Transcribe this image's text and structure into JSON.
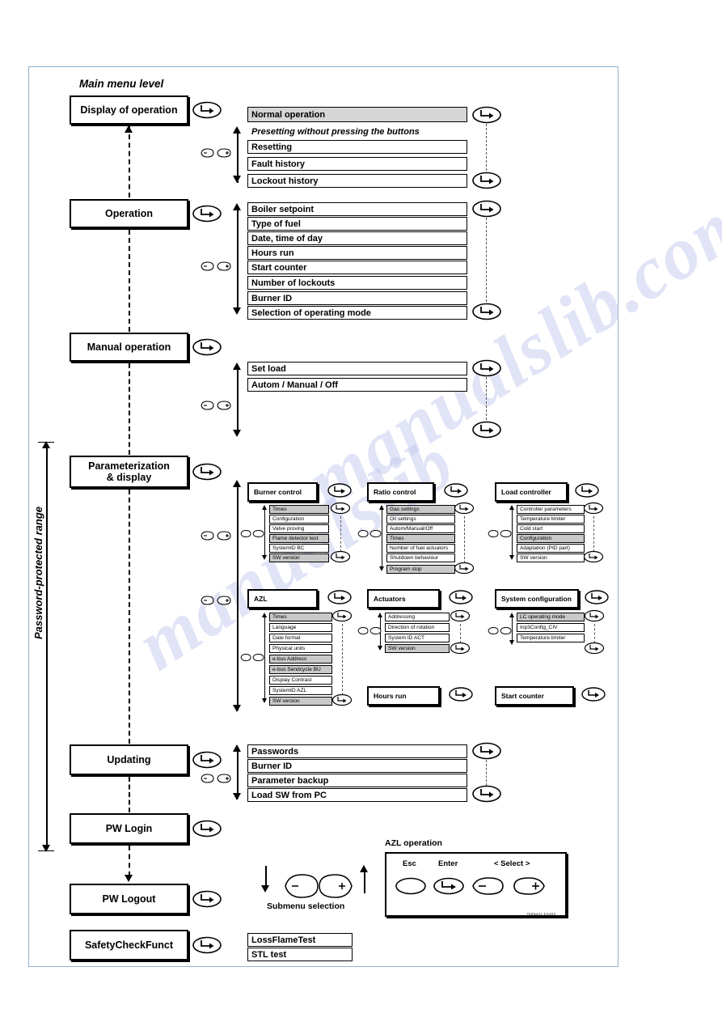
{
  "diagram": {
    "title": "Main menu level",
    "password_range_label": "Password-protected range",
    "submenu_selection_label": "Submenu selection",
    "note_presetting": "Presetting without pressing the buttons",
    "drawing_code": "7589a01 E0402"
  },
  "main_menu": [
    {
      "label": "Display of operation"
    },
    {
      "label": "Operation"
    },
    {
      "label": "Manual operation"
    },
    {
      "label": "Parameterization\n& display"
    },
    {
      "label": "Updating"
    },
    {
      "label": "PW Login"
    },
    {
      "label": "PW Logout"
    },
    {
      "label": "SafetyCheckFunct"
    }
  ],
  "display_of_operation": {
    "items": [
      "Normal operation",
      "Resetting",
      "Fault history",
      "Lockout history"
    ],
    "highlighted": "Normal operation"
  },
  "operation": {
    "items": [
      "Boiler setpoint",
      "Type of fuel",
      "Date, time of day",
      "Hours run",
      "Start counter",
      "Number of lockouts",
      "Burner ID",
      "Selection of operating mode"
    ]
  },
  "manual_operation": {
    "items": [
      "Set load",
      "Autom / Manual / Off"
    ]
  },
  "parameterization": {
    "groups": [
      {
        "label": "Burner control",
        "items": [
          "Times",
          "Configuration",
          "Valve proving",
          "Flame detector test",
          "SystemID BC",
          "SW version"
        ],
        "highlighted": [
          "Times",
          "Flame detector test",
          "SW version"
        ]
      },
      {
        "label": "Ratio control",
        "items": [
          "Gas settings",
          "Oil settings",
          "Autom/Manual/Off",
          "Times",
          "Number of fuel actuators",
          "Shutdown behaviour",
          "Program stop"
        ],
        "highlighted": [
          "Gas settings",
          "Times",
          "Program stop"
        ]
      },
      {
        "label": "Load controller",
        "items": [
          "Controller parameters",
          "Temperature limiter",
          "Cold start",
          "Configuration",
          "Adaptation (PID part)",
          "SW version"
        ],
        "highlighted": [
          "Configuration"
        ]
      },
      {
        "label": "AZL",
        "items": [
          "Times",
          "Language",
          "Date format",
          "Physical units",
          "e-bus Address",
          "e-bus Sendcycle BU",
          "Display Contrast",
          "SystemID AZL",
          "SW version"
        ],
        "highlighted": [
          "Times",
          "e-bus Address",
          "e-bus Sendcycle BU",
          "SW version"
        ]
      },
      {
        "label": "Actuators",
        "items": [
          "Addressing",
          "Direction of rotation",
          "System ID ACT",
          "SW version"
        ],
        "highlighted": [
          "SW version"
        ]
      },
      {
        "label": "System configuration",
        "items": [
          "LC operating mode",
          "Inp3Config_CIV",
          "Temperature limiter"
        ],
        "highlighted": [
          "LC operating mode"
        ]
      },
      {
        "label": "Hours run",
        "items": []
      },
      {
        "label": "Start counter",
        "items": []
      }
    ]
  },
  "updating": {
    "items": [
      "Passwords",
      "Burner ID",
      "Parameter backup",
      "Load SW from PC"
    ]
  },
  "safety_check": {
    "items": [
      "LossFlameTest",
      "STL test"
    ]
  },
  "azl_operation": {
    "title": "AZL operation",
    "keys": [
      {
        "label": "Esc",
        "glyph": "blank-ellipse"
      },
      {
        "label": "Enter",
        "glyph": "enter-arrow"
      },
      {
        "label": "< Select >",
        "glyph": "minus-plus"
      }
    ],
    "minus": "–",
    "plus": "+"
  },
  "colors": {
    "frame": "#8fb2d4",
    "row_highlight": "#d6d6d6",
    "subrow_highlight": "#c9c9c9",
    "watermark": "#c9cdf0"
  }
}
